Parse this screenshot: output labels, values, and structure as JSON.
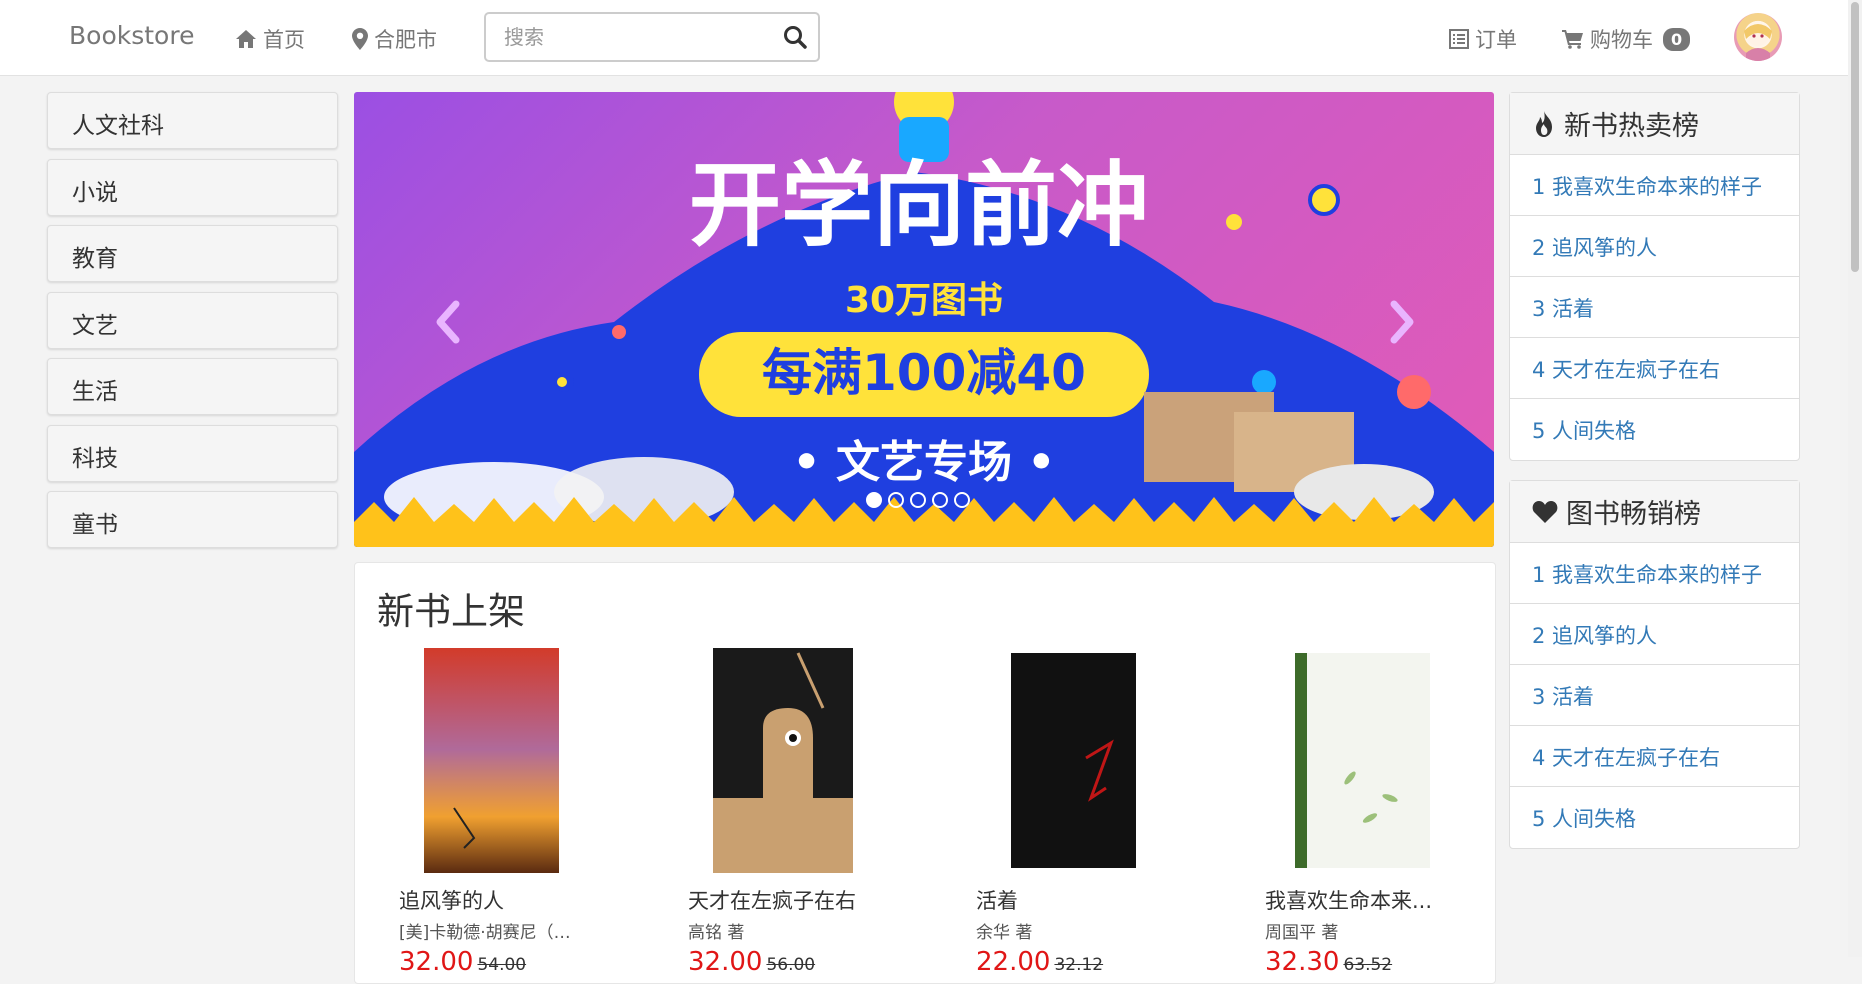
{
  "navbar": {
    "brand": "Bookstore",
    "home": "首页",
    "city": "合肥市",
    "search_placeholder": "搜索",
    "orders": "订单",
    "cart": "购物车",
    "cart_count": "0"
  },
  "categories": [
    "人文社科",
    "小说",
    "教育",
    "文艺",
    "生活",
    "科技",
    "童书"
  ],
  "carousel": {
    "headline": "开学向前冲",
    "sub1": "30万图书",
    "sub2": "每满100减40",
    "sub3": "• 文艺专场 •",
    "slide_count": 5,
    "active_slide": 1
  },
  "new_books": {
    "title": "新书上架",
    "items": [
      {
        "title": "追风筝的人",
        "author": "[美]卡勒德·胡赛尼（K...",
        "price": "32.00",
        "old_price": "54.00"
      },
      {
        "title": "天才在左疯子在右",
        "author": "高铭 著",
        "price": "32.00",
        "old_price": "56.00"
      },
      {
        "title": "活着",
        "author": "余华 著",
        "price": "22.00",
        "old_price": "32.12"
      },
      {
        "title": "我喜欢生命本来...",
        "author": "周国平 著",
        "price": "32.30",
        "old_price": "63.52"
      }
    ]
  },
  "hot_new": {
    "title": "新书热卖榜",
    "items": [
      "1 我喜欢生命本来的样子",
      "2 追风筝的人",
      "3 活着",
      "4 天才在左疯子在右",
      "5 人间失格"
    ]
  },
  "bestsellers": {
    "title": "图书畅销榜",
    "items": [
      "1 我喜欢生命本来的样子",
      "2 追风筝的人",
      "3 活着",
      "4 天才在左疯子在右",
      "5 人间失格"
    ]
  }
}
